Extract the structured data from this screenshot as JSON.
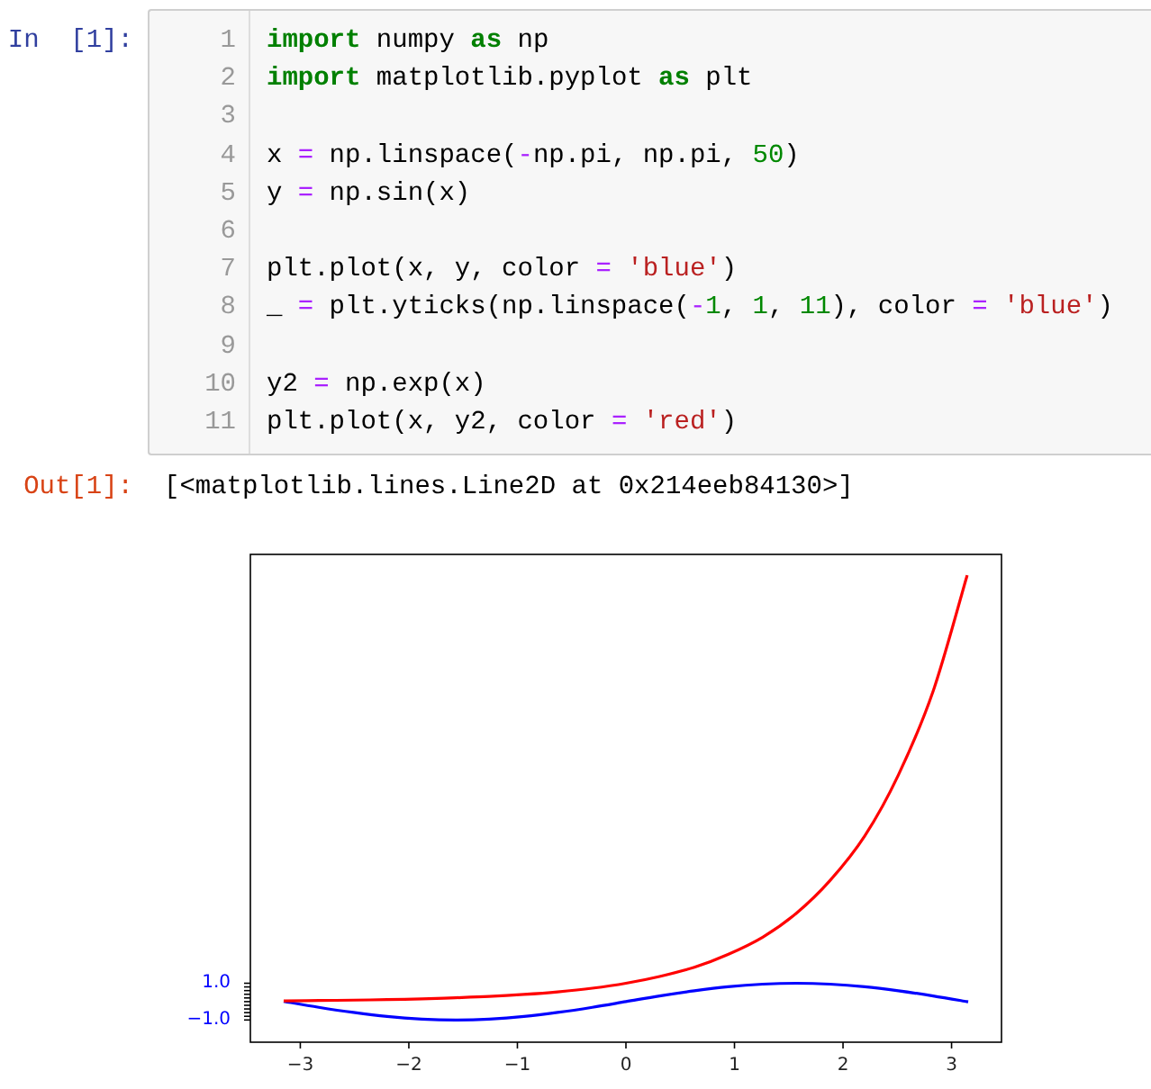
{
  "cell": {
    "prompt": "In  [1]:",
    "lines": [
      {
        "number": "1",
        "tokens": [
          {
            "kind": "keyword",
            "text": "import"
          },
          {
            "kind": "name",
            "text": " numpy "
          },
          {
            "kind": "keyword",
            "text": "as"
          },
          {
            "kind": "name",
            "text": " np"
          }
        ]
      },
      {
        "number": "2",
        "tokens": [
          {
            "kind": "keyword",
            "text": "import"
          },
          {
            "kind": "name",
            "text": " matplotlib.pyplot "
          },
          {
            "kind": "keyword",
            "text": "as"
          },
          {
            "kind": "name",
            "text": " plt"
          }
        ]
      },
      {
        "number": "3"
      },
      {
        "number": "4",
        "tokens": [
          {
            "kind": "name",
            "text": "x "
          },
          {
            "kind": "operator",
            "text": "="
          },
          {
            "kind": "name",
            "text": " np.linspace("
          },
          {
            "kind": "operator",
            "text": "-"
          },
          {
            "kind": "name",
            "text": "np.pi, np.pi, "
          },
          {
            "kind": "number",
            "text": "50"
          },
          {
            "kind": "name",
            "text": ")"
          }
        ]
      },
      {
        "number": "5",
        "tokens": [
          {
            "kind": "name",
            "text": "y "
          },
          {
            "kind": "operator",
            "text": "="
          },
          {
            "kind": "name",
            "text": " np.sin(x)"
          }
        ]
      },
      {
        "number": "6"
      },
      {
        "number": "7",
        "tokens": [
          {
            "kind": "name",
            "text": "plt.plot(x, y, color "
          },
          {
            "kind": "operator",
            "text": "= "
          },
          {
            "kind": "string",
            "text": "'blue'"
          },
          {
            "kind": "name",
            "text": ")"
          }
        ]
      },
      {
        "number": "8",
        "tokens": [
          {
            "kind": "name",
            "text": "_ "
          },
          {
            "kind": "operator",
            "text": "="
          },
          {
            "kind": "name",
            "text": " plt.yticks(np.linspace("
          },
          {
            "kind": "operator",
            "text": "-"
          },
          {
            "kind": "number",
            "text": "1"
          },
          {
            "kind": "name",
            "text": ", "
          },
          {
            "kind": "number",
            "text": "1"
          },
          {
            "kind": "name",
            "text": ", "
          },
          {
            "kind": "number",
            "text": "11"
          },
          {
            "kind": "name",
            "text": "), color "
          },
          {
            "kind": "operator",
            "text": "= "
          },
          {
            "kind": "string",
            "text": "'blue'"
          },
          {
            "kind": "name",
            "text": ")"
          }
        ]
      },
      {
        "number": "9"
      },
      {
        "number": "10",
        "tokens": [
          {
            "kind": "name",
            "text": "y2 "
          },
          {
            "kind": "operator",
            "text": "="
          },
          {
            "kind": "name",
            "text": " np.exp(x)"
          }
        ]
      },
      {
        "number": "11",
        "tokens": [
          {
            "kind": "name",
            "text": "plt.plot(x, y2, color "
          },
          {
            "kind": "operator",
            "text": "= "
          },
          {
            "kind": "string",
            "text": "'red'"
          },
          {
            "kind": "name",
            "text": ")"
          }
        ]
      }
    ]
  },
  "output": {
    "prompt": "Out[1]:",
    "text": "[<matplotlib.lines.Line2D at 0x214eeb84130>]",
    "chart_data": {
      "type": "line",
      "x": [
        -3.14,
        -2.83,
        -2.51,
        -2.2,
        -1.88,
        -1.57,
        -1.26,
        -0.94,
        -0.63,
        -0.31,
        0,
        0.31,
        0.63,
        0.94,
        1.26,
        1.57,
        1.88,
        2.2,
        2.51,
        2.83,
        3.14
      ],
      "series": [
        {
          "color": "#0000ff",
          "values": [
            0,
            -0.31,
            -0.59,
            -0.81,
            -0.95,
            -1,
            -0.95,
            -0.81,
            -0.59,
            -0.31,
            0,
            0.31,
            0.59,
            0.81,
            0.95,
            1,
            0.95,
            0.81,
            0.59,
            0.31,
            0
          ]
        },
        {
          "color": "#ff0000",
          "values": [
            0.04,
            0.06,
            0.08,
            0.11,
            0.15,
            0.21,
            0.28,
            0.39,
            0.53,
            0.73,
            1,
            1.37,
            1.87,
            2.57,
            3.51,
            4.81,
            6.59,
            9.02,
            12.34,
            16.9,
            23.14
          ]
        }
      ],
      "xlim": [
        -3.46,
        3.46
      ],
      "ylim": [
        -2.21,
        24.35
      ],
      "xticks": [
        {
          "value": -3,
          "label": "−3"
        },
        {
          "value": -2,
          "label": "−2"
        },
        {
          "value": -1,
          "label": "−1"
        },
        {
          "value": 0,
          "label": "0"
        },
        {
          "value": 1,
          "label": "1"
        },
        {
          "value": 2,
          "label": "2"
        },
        {
          "value": 3,
          "label": "3"
        }
      ],
      "yticks": [
        {
          "value": -1,
          "label": "−1.0"
        },
        {
          "value": 1,
          "label": "1.0"
        }
      ]
    }
  }
}
